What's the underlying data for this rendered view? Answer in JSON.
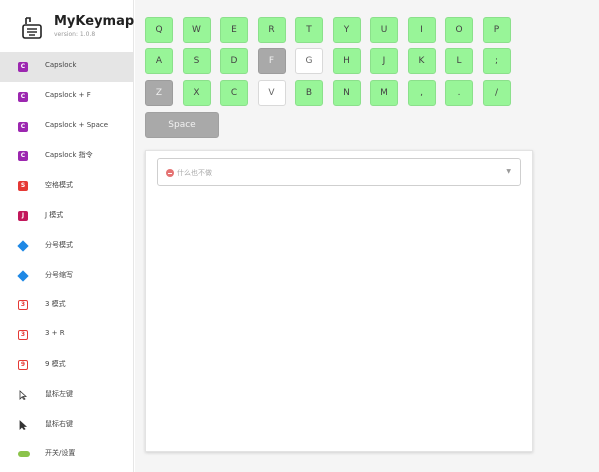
{
  "app": {
    "title": "MyKeymap",
    "version": "version: 1.0.8"
  },
  "sidebar": {
    "items": [
      {
        "label": "Capslock",
        "icon": "capslock-icon",
        "glyph": "C",
        "active": true
      },
      {
        "label": "Capslock + F",
        "icon": "capslock-f-icon",
        "glyph": "C"
      },
      {
        "label": "Capslock + Space",
        "icon": "capslock-space-icon",
        "glyph": "C"
      },
      {
        "label": "Capslock 指令",
        "icon": "capslock-command-icon",
        "glyph": "C"
      },
      {
        "label": "空格模式",
        "icon": "space-mode-icon",
        "glyph": "S"
      },
      {
        "label": "J 模式",
        "icon": "j-mode-icon",
        "glyph": "J"
      },
      {
        "label": "分号模式",
        "icon": "semicolon-mode-icon"
      },
      {
        "label": "分号缩写",
        "icon": "semicolon-abbr-icon"
      },
      {
        "label": "3 模式",
        "icon": "three-mode-icon",
        "glyph": "3"
      },
      {
        "label": "3 + R",
        "icon": "three-r-icon",
        "glyph": "3"
      },
      {
        "label": "9 模式",
        "icon": "nine-mode-icon",
        "glyph": "9"
      },
      {
        "label": "鼠标左键",
        "icon": "mouse-left-icon"
      },
      {
        "label": "鼠标右键",
        "icon": "mouse-right-icon"
      },
      {
        "label": "开关/设置",
        "icon": "toggle-settings-icon"
      }
    ]
  },
  "keyboard": {
    "rows": [
      [
        "Q",
        "W",
        "E",
        "R",
        "T",
        "Y",
        "U",
        "I",
        "O",
        "P"
      ],
      [
        "A",
        "S",
        "D",
        "F",
        "G",
        "H",
        "J",
        "K",
        "L",
        ";"
      ],
      [
        "Z",
        "X",
        "C",
        "V",
        "B",
        "N",
        "M",
        ",",
        ".",
        "/"
      ]
    ],
    "space_label": "Space",
    "states": {
      "F": "disabled",
      "G": "unset",
      "Z": "disabled",
      "V": "unset"
    }
  },
  "action_panel": {
    "select_placeholder": "什么也不做",
    "select_icon": "no-action-icon",
    "caret_icon": "chevron-down-icon"
  },
  "colors": {
    "key_configured": "#98f598",
    "key_disabled": "#a9a9a9",
    "key_unset": "#ffffff",
    "sidebar_active": "#e5e5e5"
  }
}
